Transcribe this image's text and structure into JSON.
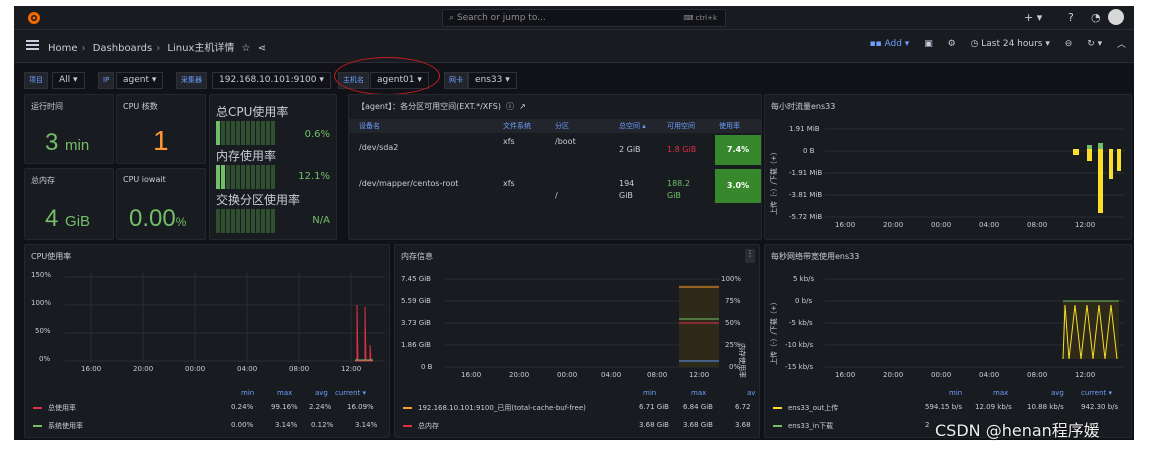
{
  "topbar": {
    "search_placeholder": "Search or jump to...",
    "shortcut": "ctrl+k",
    "icons": [
      "grafana-logo-icon",
      "plus-icon",
      "help-icon",
      "rss-icon",
      "user-avatar-icon"
    ]
  },
  "nav": {
    "breadcrumbs": [
      "Home",
      "Dashboards",
      "Linux主机详情"
    ],
    "add_label": "Add",
    "time_range": "Last 24 hours"
  },
  "variables": [
    {
      "label": "项目",
      "value": "All"
    },
    {
      "label": "IP",
      "value": "agent"
    },
    {
      "label": "采集器",
      "value": "192.168.10.101:9100"
    },
    {
      "label": "主机名",
      "value": "agent01"
    },
    {
      "label": "网卡",
      "value": "ens33"
    }
  ],
  "stats": {
    "uptime": {
      "title": "运行时间",
      "value": "3",
      "unit": "min"
    },
    "cpu_cores": {
      "title": "CPU 核数",
      "value": "1"
    },
    "memory": {
      "title": "总内存",
      "value": "4",
      "unit": "GiB"
    },
    "cpu_iowait": {
      "title": "CPU iowait",
      "value": "0.00",
      "unit": "%"
    }
  },
  "bargauges": [
    {
      "title": "总CPU使用率",
      "value": "0.6%",
      "fill": 0.006
    },
    {
      "title": "内存使用率",
      "value": "12.1%",
      "fill": 0.121
    },
    {
      "title": "交换分区使用率",
      "value": "N/A",
      "fill": 0
    }
  ],
  "disk_table": {
    "title": "【agent】：各分区可用空间(EXT.*/XFS)",
    "headers": [
      "设备名",
      "文件系统",
      "分区",
      "总空间",
      "可用空间",
      "使用率"
    ],
    "rows": [
      {
        "device": "/dev/sda2",
        "fs": "xfs",
        "mount": "/boot",
        "total": "2 GiB",
        "avail": "1.8 GiB",
        "usage": "7.4%"
      },
      {
        "device": "/dev/mapper/centos-root",
        "fs": "xfs",
        "mount": "/",
        "total_1": "194",
        "total_2": "GiB",
        "avail_1": "188.2",
        "avail_2": "GiB",
        "usage": "3.0%"
      }
    ]
  },
  "traffic_hourly": {
    "title": "每小时流量ens33",
    "ylabel": "上传（-）/下载（+）",
    "yticks": [
      "1.91 MiB",
      "0 B",
      "-1.91 MiB",
      "-3.81 MiB",
      "-5.72 MiB"
    ],
    "xticks": [
      "16:00",
      "20:00",
      "00:00",
      "04:00",
      "08:00",
      "12:00"
    ]
  },
  "cpu_usage": {
    "title": "CPU使用率",
    "yticks": [
      "150%",
      "100%",
      "50%",
      "0%"
    ],
    "xticks": [
      "16:00",
      "20:00",
      "00:00",
      "04:00",
      "08:00",
      "12:00"
    ],
    "legend_headers": [
      "min",
      "max",
      "avg",
      "current"
    ],
    "legend": [
      {
        "name": "总使用率",
        "color": "#e02f44",
        "min": "0.24%",
        "max": "99.16%",
        "avg": "2.24%",
        "current": "16.09%"
      },
      {
        "name": "系统使用率",
        "color": "#73bf69",
        "min": "0.00%",
        "max": "3.14%",
        "avg": "0.12%",
        "current": "3.14%"
      }
    ]
  },
  "memory_info": {
    "title": "内存信息",
    "ylabel_right": "内存使用率",
    "yticks": [
      "7.45 GiB",
      "5.59 GiB",
      "3.73 GiB",
      "1.86 GiB",
      "0 B"
    ],
    "yticks_right": [
      "100%",
      "75%",
      "50%",
      "25%",
      "0%"
    ],
    "xticks": [
      "16:00",
      "20:00",
      "00:00",
      "04:00",
      "08:00",
      "12:00"
    ],
    "legend_headers": [
      "min",
      "max",
      "av"
    ],
    "legend": [
      {
        "name": "192.168.10.101:9100_已用(total-cache-buf-free)",
        "color": "#ff9830",
        "min": "6.71 GiB",
        "max": "6.84 GiB",
        "avg": "6.72"
      },
      {
        "name": "总内存",
        "color": "#e02f44",
        "min": "3.68 GiB",
        "max": "3.68 GiB",
        "avg": "3.68"
      }
    ]
  },
  "bandwidth": {
    "title": "每秒网络带宽使用ens33",
    "ylabel": "上传（-）/下载（+）",
    "yticks": [
      "5 kb/s",
      "0 b/s",
      "-5 kb/s",
      "-10 kb/s",
      "-15 kb/s"
    ],
    "xticks": [
      "16:00",
      "20:00",
      "00:00",
      "04:00",
      "08:00",
      "12:00"
    ],
    "legend_headers": [
      "min",
      "max",
      "avg",
      "current"
    ],
    "legend": [
      {
        "name": "ens33_out上传",
        "color": "#fade2a",
        "min": "594.15 b/s",
        "max": "12.09 kb/s",
        "avg": "10.88 kb/s",
        "current": "942.30 b/s"
      },
      {
        "name": "ens33_in下载",
        "color": "#73bf69",
        "min": "2",
        "max": "",
        "avg": "",
        "current": ""
      }
    ]
  },
  "watermark": "CSDN @henan程序媛"
}
